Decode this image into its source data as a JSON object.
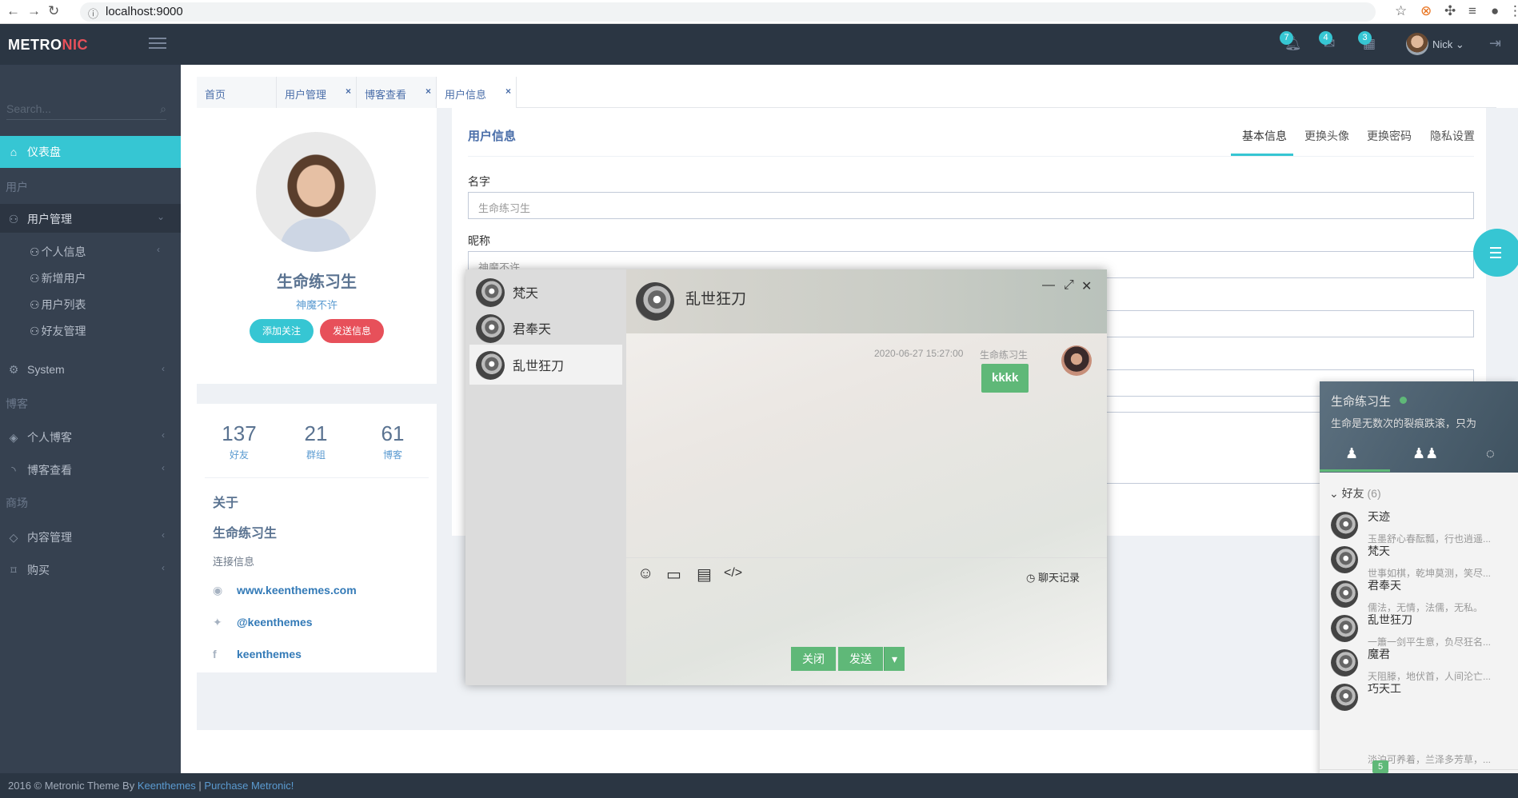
{
  "browser": {
    "url": "localhost:9000"
  },
  "header": {
    "logo_a": "METRO",
    "logo_b": "NIC",
    "badges": [
      "7",
      "4",
      "3"
    ],
    "user": "Nick"
  },
  "sidebar": {
    "search_placeholder": "Search...",
    "dashboard": "仪表盘",
    "section_user": "用户",
    "user_mgmt": "用户管理",
    "subs": [
      "个人信息",
      "新增用户",
      "用户列表",
      "好友管理"
    ],
    "system": "System",
    "section_blog": "博客",
    "my_blog": "个人博客",
    "blog_view": "博客查看",
    "section_shop": "商场",
    "content_mgmt": "内容管理",
    "buy": "购买"
  },
  "tabs": [
    "首页",
    "用户管理",
    "博客查看",
    "用户信息"
  ],
  "profile": {
    "name": "生命练习生",
    "nickname": "神魔不许",
    "follow": "添加关注",
    "message": "发送信息",
    "stats": [
      {
        "value": "137",
        "label": "好友"
      },
      {
        "value": "21",
        "label": "群组"
      },
      {
        "value": "61",
        "label": "博客"
      }
    ],
    "about_title": "关于",
    "about_name": "生命练习生",
    "contact_title": "连接信息",
    "links": [
      "www.keenthemes.com",
      "@keenthemes",
      "keenthemes"
    ]
  },
  "info": {
    "title": "用户信息",
    "tabs": [
      "基本信息",
      "更换头像",
      "更换密码",
      "隐私设置"
    ],
    "name_label": "名字",
    "name_value": "生命练习生",
    "nick_label": "昵称",
    "nick_value": "神魔不许"
  },
  "chat": {
    "contacts": [
      "梵天",
      "君奉天",
      "乱世狂刀"
    ],
    "active_name": "乱世狂刀",
    "message": {
      "time": "2020-06-27 15:27:00",
      "user": "生命练习生",
      "text": "kkkk"
    },
    "history": "聊天记录",
    "close": "关闭",
    "send": "发送"
  },
  "im": {
    "name": "生命练习生",
    "sign": "生命是无数次的裂痕跌滚，只为",
    "group": "好友",
    "group_count": "(6)",
    "friends": [
      {
        "name": "天迹",
        "sign": ""
      },
      {
        "name": "梵天",
        "sign": "玉墨舒心春酝瓢，行也逍遥..."
      },
      {
        "name": "君奉天",
        "sign": "世事如棋，乾坤莫测，笑尽..."
      },
      {
        "name": "乱世狂刀",
        "sign": "儒法，无情，法儒，无私。"
      },
      {
        "name": "魔君",
        "sign": "一簫一剑平生意，负尽狂名..."
      },
      {
        "name": "巧天工",
        "sign": "天阻滕，地伏首，人间沦亡..."
      }
    ],
    "last_sign": "淡泊可养着，兰泽多芳草，...",
    "badge": "5"
  },
  "footer": {
    "text": "2016 © Metronic Theme By ",
    "link1": "Keenthemes",
    "sep": " | ",
    "link2": "Purchase Metronic!"
  },
  "colors": {
    "accent": "#36c6d3",
    "danger": "#e7505a",
    "sidebar": "#364150",
    "header": "#2b3643",
    "chat_green": "#5fb878"
  }
}
